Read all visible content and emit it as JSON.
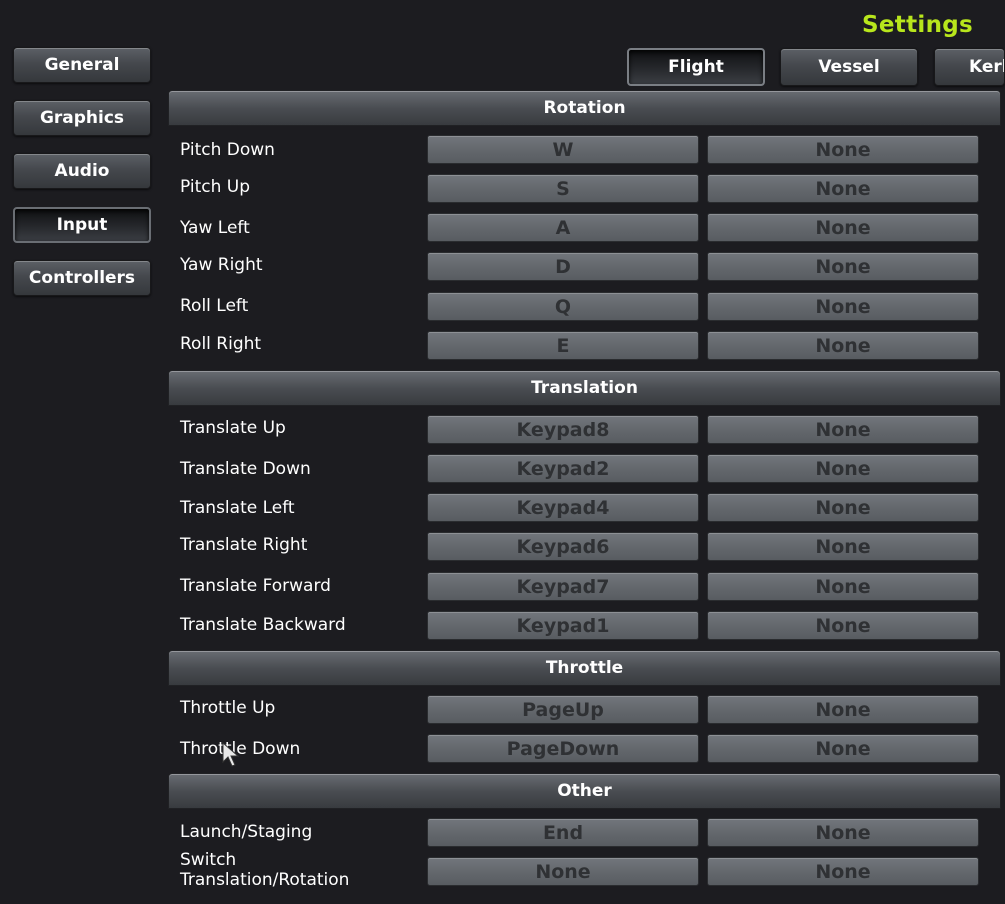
{
  "title": "Settings",
  "sidebar": {
    "items": [
      {
        "label": "General"
      },
      {
        "label": "Graphics"
      },
      {
        "label": "Audio"
      },
      {
        "label": "Input",
        "active": true
      },
      {
        "label": "Controllers"
      }
    ]
  },
  "tabs": [
    {
      "label": "Flight",
      "active": true
    },
    {
      "label": "Vessel"
    },
    {
      "label": "Kerb"
    }
  ],
  "sections": {
    "rotation": {
      "title": "Rotation",
      "rows": [
        {
          "label": "Pitch Down",
          "primary": "W",
          "secondary": "None"
        },
        {
          "label": "Pitch Up",
          "primary": "S",
          "secondary": "None"
        },
        {
          "label": "Yaw Left",
          "primary": "A",
          "secondary": "None"
        },
        {
          "label": "Yaw Right",
          "primary": "D",
          "secondary": "None"
        },
        {
          "label": "Roll Left",
          "primary": "Q",
          "secondary": "None"
        },
        {
          "label": "Roll Right",
          "primary": "E",
          "secondary": "None"
        }
      ]
    },
    "translation": {
      "title": "Translation",
      "rows": [
        {
          "label": "Translate Up",
          "primary": "Keypad8",
          "secondary": "None"
        },
        {
          "label": "Translate Down",
          "primary": "Keypad2",
          "secondary": "None"
        },
        {
          "label": "Translate Left",
          "primary": "Keypad4",
          "secondary": "None"
        },
        {
          "label": "Translate Right",
          "primary": "Keypad6",
          "secondary": "None"
        },
        {
          "label": "Translate Forward",
          "primary": "Keypad7",
          "secondary": "None"
        },
        {
          "label": "Translate Backward",
          "primary": "Keypad1",
          "secondary": "None"
        }
      ]
    },
    "throttle": {
      "title": "Throttle",
      "rows": [
        {
          "label": "Throttle Up",
          "primary": "PageUp",
          "secondary": "None"
        },
        {
          "label": "Throttle Down",
          "primary": "PageDown",
          "secondary": "None"
        }
      ]
    },
    "other": {
      "title": "Other",
      "rows": [
        {
          "label": "Launch/Staging",
          "primary": "End",
          "secondary": "None"
        },
        {
          "label": "Switch",
          "label_line2": "Translation/Rotation",
          "primary": "None",
          "secondary": "None"
        }
      ]
    }
  },
  "colors": {
    "title": "#b8e61c",
    "background": "#1c1c20",
    "key_text": "#2f3134"
  }
}
